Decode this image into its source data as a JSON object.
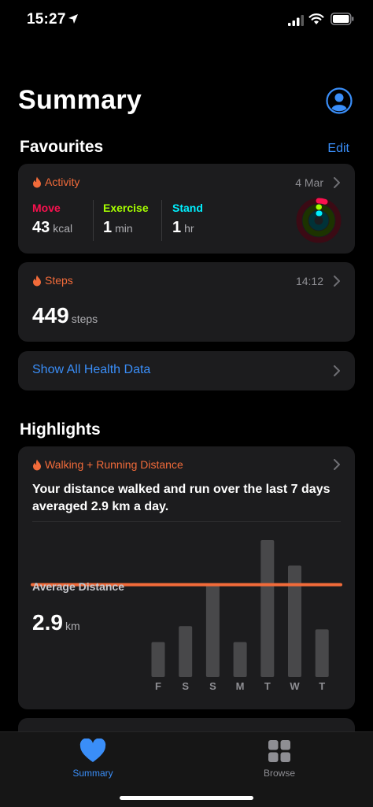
{
  "status_bar": {
    "time": "15:27"
  },
  "header": {
    "title": "Summary"
  },
  "favourites": {
    "title": "Favourites",
    "edit_label": "Edit",
    "activity": {
      "category": "Activity",
      "date": "4 Mar",
      "move": {
        "label": "Move",
        "value": "43",
        "unit": "kcal",
        "color": "#fa114f"
      },
      "exercise": {
        "label": "Exercise",
        "value": "1",
        "unit": "min",
        "color": "#a6ff00"
      },
      "stand": {
        "label": "Stand",
        "value": "1",
        "unit": "hr",
        "color": "#00f0ff"
      }
    },
    "steps": {
      "category": "Steps",
      "time": "14:12",
      "value": "449",
      "unit": "steps"
    },
    "show_all_label": "Show All Health Data"
  },
  "highlights": {
    "title": "Highlights",
    "card": {
      "category": "Walking + Running Distance",
      "text": "Your distance walked and run over the last 7 days averaged 2.9 km a day.",
      "avg_label": "Average Distance",
      "avg_value": "2.9",
      "avg_unit": "km"
    }
  },
  "chart_data": {
    "type": "bar",
    "categories": [
      "F",
      "S",
      "S",
      "M",
      "T",
      "W",
      "T"
    ],
    "values": [
      1.1,
      1.6,
      2.9,
      1.1,
      4.3,
      3.5,
      1.5
    ],
    "average": 2.9,
    "ylim": [
      0,
      4.4
    ],
    "bar_color": "#48484a",
    "average_line_color": "#f26b3a"
  },
  "tabs": [
    {
      "label": "Summary",
      "icon": "heart-icon",
      "active": true
    },
    {
      "label": "Browse",
      "icon": "grid-icon",
      "active": false
    }
  ],
  "colors": {
    "accent": "#3a8ef8",
    "health_orange": "#f26b3a"
  }
}
